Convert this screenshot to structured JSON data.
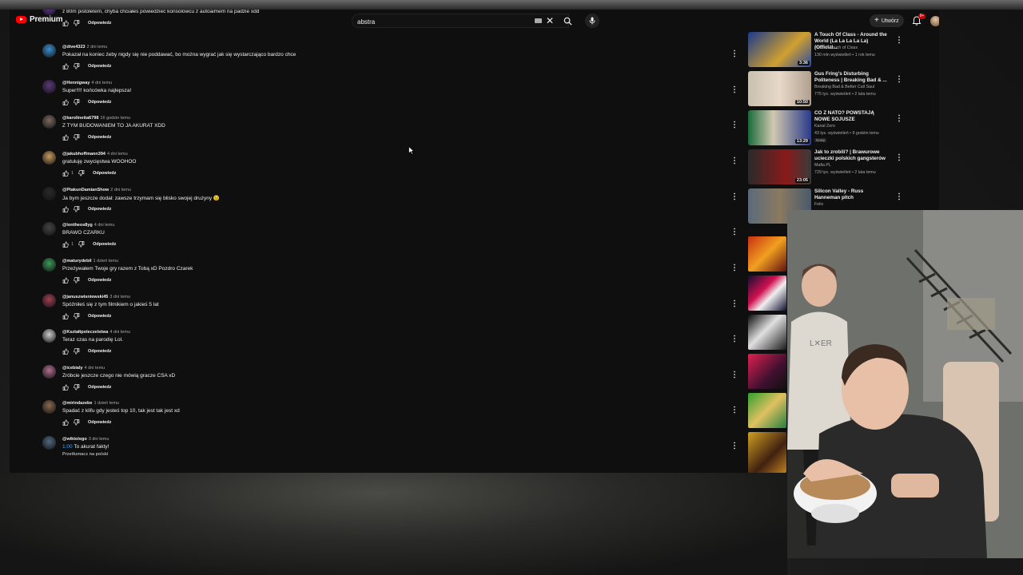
{
  "masthead": {
    "logo_text": "Premium",
    "search_value": "abstra",
    "create_label": "Utwórz",
    "notification_count": "9+"
  },
  "comments": [
    {
      "author": "",
      "time": "",
      "text": "z 80m pistoletem, chyba chciałeś powiedzieć konsolowcu z autoaimem na padzie xdd",
      "likes": "",
      "reply": "Odpowiedz",
      "avatar_color": "#6b3aa0"
    },
    {
      "author": "@dive4323",
      "time": "2 dni temu",
      "text": "Pokazał na koniec żeby nigdy się nie poddawać, bo można wygrać jak się wystarczająco bardzo chce",
      "likes": "",
      "reply": "Odpowiedz",
      "avatar_color": "#3a8fd0"
    },
    {
      "author": "@Hennigway",
      "time": "4 dni temu",
      "text": "Super!!!! końcówka najlepsza!",
      "likes": "",
      "reply": "Odpowiedz",
      "avatar_color": "#5a3a7a"
    },
    {
      "author": "@karolinetta6798",
      "time": "16 godzin temu",
      "text": "Z TYM BUDOWANIEM TO JA AKURAT XDD",
      "likes": "",
      "reply": "Odpowiedz",
      "avatar_color": "#7a6a60"
    },
    {
      "author": "@jakubhoffmann394",
      "time": "4 dni temu",
      "text": "gratuluję zwycięstwa WOOHOO",
      "likes": "1",
      "reply": "Odpowiedz",
      "avatar_color": "#c89a60"
    },
    {
      "author": "@PtakunDamianShow",
      "time": "2 dni temu",
      "text": "Ja bym jeszcze dodał: zawsze trzymam się blisko swojej drużyny 😉",
      "likes": "",
      "reply": "Odpowiedz",
      "avatar_color": "#2a2a2a"
    },
    {
      "author": "@lontheos8yg",
      "time": "4 dni temu",
      "text": "BRAWO CZARKU",
      "likes": "1",
      "reply": "Odpowiedz",
      "avatar_color": "#444444"
    },
    {
      "author": "@maturydebil",
      "time": "1 dzień temu",
      "text": "Przeżywałem Twoje gry razem z Tobą xD Pozdro Czarek",
      "likes": "",
      "reply": "Odpowiedz",
      "avatar_color": "#3a9a5a"
    },
    {
      "author": "@januszwisniewski45",
      "time": "3 dni temu",
      "text": "Spóźniłeś się z tym filmikiem o jakieś 5 lat",
      "likes": "",
      "reply": "Odpowiedz",
      "avatar_color": "#a04050"
    },
    {
      "author": "@Kształtpoleczelstwa",
      "time": "4 dni temu",
      "text": "Teraz czas na parodię Lol.",
      "likes": "",
      "reply": "Odpowiedz",
      "avatar_color": "#cccccc"
    },
    {
      "author": "@icebialy",
      "time": "4 dni temu",
      "text": "Zróbcie jeszcze czego nie mówią gracze CSA xD",
      "likes": "",
      "reply": "Odpowiedz",
      "avatar_color": "#b07090"
    },
    {
      "author": "@mirindazebe",
      "time": "1 dzień temu",
      "text": "Spadać z klifu gdy jesteś top 10, tak jest tak jest xd",
      "likes": "",
      "reply": "Odpowiedz",
      "avatar_color": "#8a6a50"
    },
    {
      "author": "@wiktolego",
      "time": "3 dni temu",
      "text": "To akurat fakty!",
      "timestamp": "1:00",
      "translate": "Przetłumacz na polski",
      "likes": "",
      "reply": "",
      "avatar_color": "#506a80"
    }
  ],
  "recommendations": [
    {
      "title": "A Touch Of Class - Around the World (La La La La La) (Official...",
      "channel": "ATC - A Touch of Class",
      "meta": "130 mln wyświetleń • 1 rok temu",
      "duration": "3:36",
      "thumb": "linear-gradient(135deg,#1a3a8a,#d0a030 60%,#2a4aa0)"
    },
    {
      "title": "Gus Fring's Disturbing Politeness | Breaking Bad & ...",
      "channel": "Breaking Bad & Better Call Saul",
      "meta": "775 tys. wyświetleń • 2 lata temu",
      "duration": "10:50",
      "thumb": "linear-gradient(90deg,#c8c0b0,#e8d8c8 50%,#b0a090)"
    },
    {
      "title": "CO Z NATO? POWSTAJĄ NOWE SOJUSZE",
      "channel": "Kanał Zero",
      "meta": "43 tys. wyświetleń • 9 godzin temu",
      "badge": "Nowy",
      "duration": "13:29",
      "thumb": "linear-gradient(90deg,#1a6a3a,#d0c8b0 40%,#2a3a8a)"
    },
    {
      "title": "Jak to zrobili? | Brawurowe ucieczki polskich gangsterów",
      "channel": "Mafia PL",
      "meta": "729 tys. wyświetleń • 2 lata temu",
      "duration": "23:05",
      "thumb": "linear-gradient(90deg,#2a2a2a,#8a1a1a 60%,#3a3a3a)"
    },
    {
      "title": "Silicon Valley - Russ Hanneman pitch",
      "channel": "Felix",
      "meta": "",
      "duration": "",
      "thumb": "linear-gradient(90deg,#5a6a7a,#8a7a60 50%,#4a5a6a)"
    }
  ],
  "thumbs_only": [
    {
      "thumb": "linear-gradient(135deg,#c83010,#f0a020 50%,#601010)"
    },
    {
      "thumb": "linear-gradient(135deg,#101030,#d01050 40%,#f0f0f0 60%,#101030)"
    },
    {
      "thumb": "linear-gradient(135deg,#0a0a0a,#e0e0e0 45%,#1a1a1a)"
    },
    {
      "thumb": "linear-gradient(135deg,#e02050,#401030 60%,#101010)"
    },
    {
      "thumb": "linear-gradient(135deg,#30a030,#e0c060 50%,#208040)"
    },
    {
      "thumb": "linear-gradient(135deg,#d0a020,#402010 60%,#c08020)"
    }
  ]
}
